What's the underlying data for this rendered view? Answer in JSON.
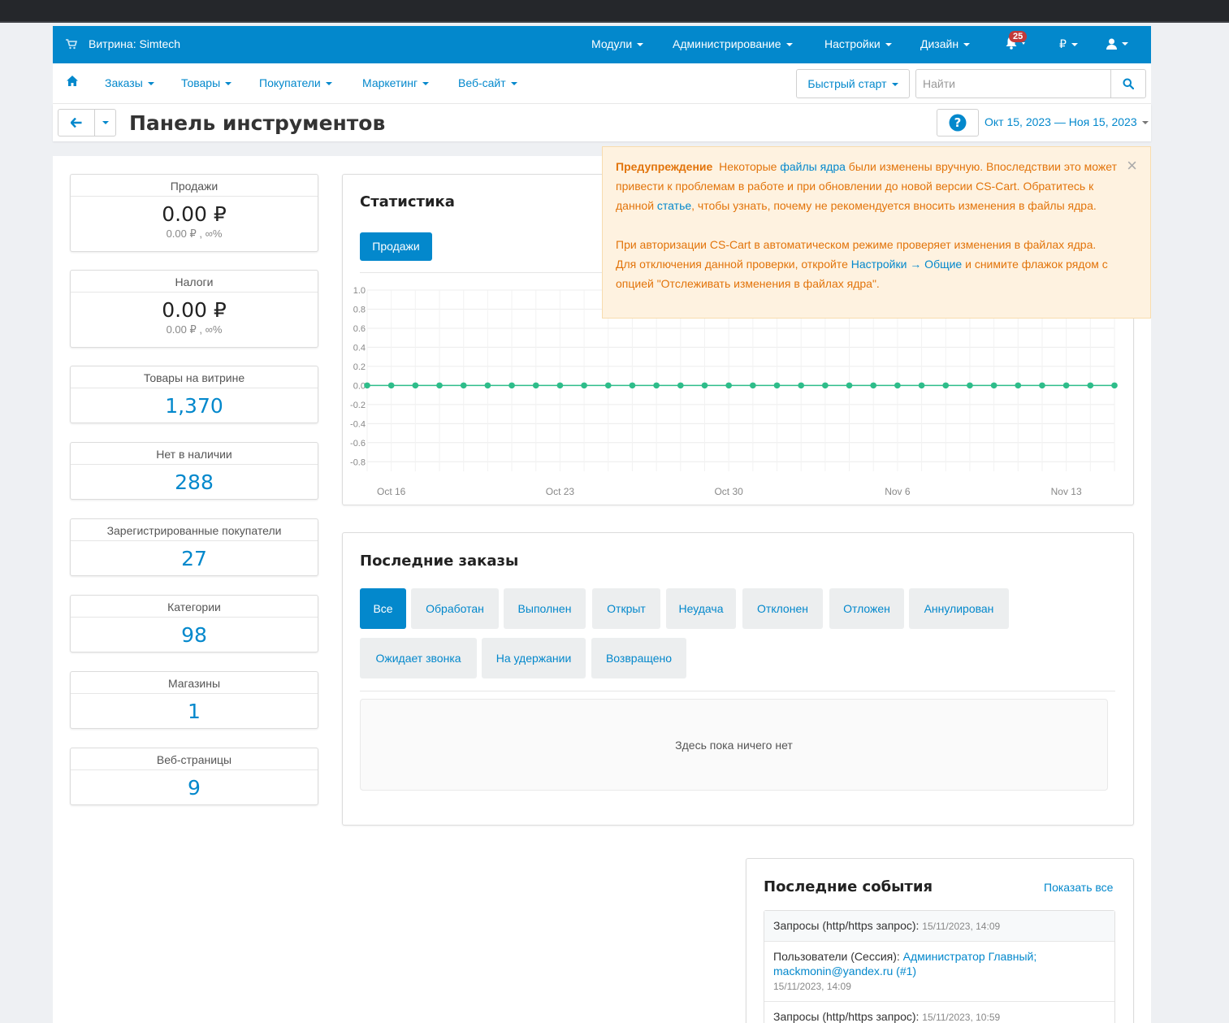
{
  "topbar": {
    "store_label": "Витрина: Simtech",
    "menus": [
      "Модули",
      "Администрирование",
      "Настройки",
      "Дизайн"
    ],
    "notifications_count": "25",
    "currency": "₽",
    "colors": {
      "primary": "#0388cc"
    }
  },
  "nav": {
    "items": [
      "Заказы",
      "Товары",
      "Покупатели",
      "Маркетинг",
      "Веб-сайт"
    ],
    "quick_start": "Быстрый старт",
    "search_placeholder": "Найти"
  },
  "title": {
    "page_title": "Панель инструментов",
    "date_range": "Окт 15, 2023 — Ноя 15, 2023"
  },
  "stats": [
    {
      "label": "Продажи",
      "value": "0.00 ₽",
      "sub": "0.00 ₽ , ∞%"
    },
    {
      "label": "Налоги",
      "value": "0.00 ₽",
      "sub": "0.00 ₽ , ∞%"
    },
    {
      "label": "Товары на витрине",
      "value": "1,370"
    },
    {
      "label": "Нет в наличии",
      "value": "288"
    },
    {
      "label": "Зарегистрированные покупатели",
      "value": "27"
    },
    {
      "label": "Категории",
      "value": "98"
    },
    {
      "label": "Магазины",
      "value": "1"
    },
    {
      "label": "Веб-страницы",
      "value": "9"
    }
  ],
  "statistics": {
    "title": "Статистика",
    "tab": "Продажи"
  },
  "chart_data": {
    "type": "line",
    "x_labels": [
      "Oct 16",
      "Oct 23",
      "Oct 30",
      "Nov 6",
      "Nov 13"
    ],
    "x_start": "Oct 15",
    "points_count": 32,
    "values": [
      0,
      0,
      0,
      0,
      0,
      0,
      0,
      0,
      0,
      0,
      0,
      0,
      0,
      0,
      0,
      0,
      0,
      0,
      0,
      0,
      0,
      0,
      0,
      0,
      0,
      0,
      0,
      0,
      0,
      0,
      0,
      0
    ],
    "y_ticks": [
      "1.0",
      "0.8",
      "0.6",
      "0.4",
      "0.2",
      "0.0",
      "-0.2",
      "-0.4",
      "-0.6",
      "-0.8"
    ],
    "ylim": [
      -0.9,
      1.0
    ],
    "color": "#2ebd8a",
    "grid": true
  },
  "orders": {
    "title": "Последние заказы",
    "tabs": [
      "Все",
      "Обработан",
      "Выполнен",
      "Открыт",
      "Неудача",
      "Отклонен",
      "Отложен",
      "Аннулирован",
      "Ожидает звонка",
      "На удержании",
      "Возвращено"
    ],
    "empty": "Здесь пока ничего нет"
  },
  "events": {
    "title": "Последние события",
    "show_all": "Показать все",
    "items": [
      {
        "type": "Запросы (http/https запрос):",
        "time": "15/11/2023, 14:09"
      },
      {
        "type": "Пользователи (Сессия):",
        "link": "Администратор Главный; mackmonin@yandex.ru (#1)",
        "time": "15/11/2023, 14:09"
      },
      {
        "type": "Запросы (http/https запрос):",
        "time": "15/11/2023, 10:59"
      }
    ]
  },
  "warning": {
    "title": "Предупреждение",
    "t1": "Некоторые",
    "link1": "файлы ядра",
    "t2": "были изменены вручную. Впоследствии это может привести к проблемам в работе и при обновлении до новой версии CS-Cart. Обратитесь к данной",
    "link2": "статье",
    "t3": ", чтобы узнать, почему не рекомендуется вносить изменения в файлы ядра.",
    "t4": "При авторизации CS-Cart в автоматическом режиме проверяет изменения в файлах ядра. Для отключения данной проверки, откройте",
    "link3": "Настройки → Общие",
    "t5": "и снимите флажок рядом с опцией \"Отслеживать изменения в файлах ядра\".",
    "close": "×"
  }
}
